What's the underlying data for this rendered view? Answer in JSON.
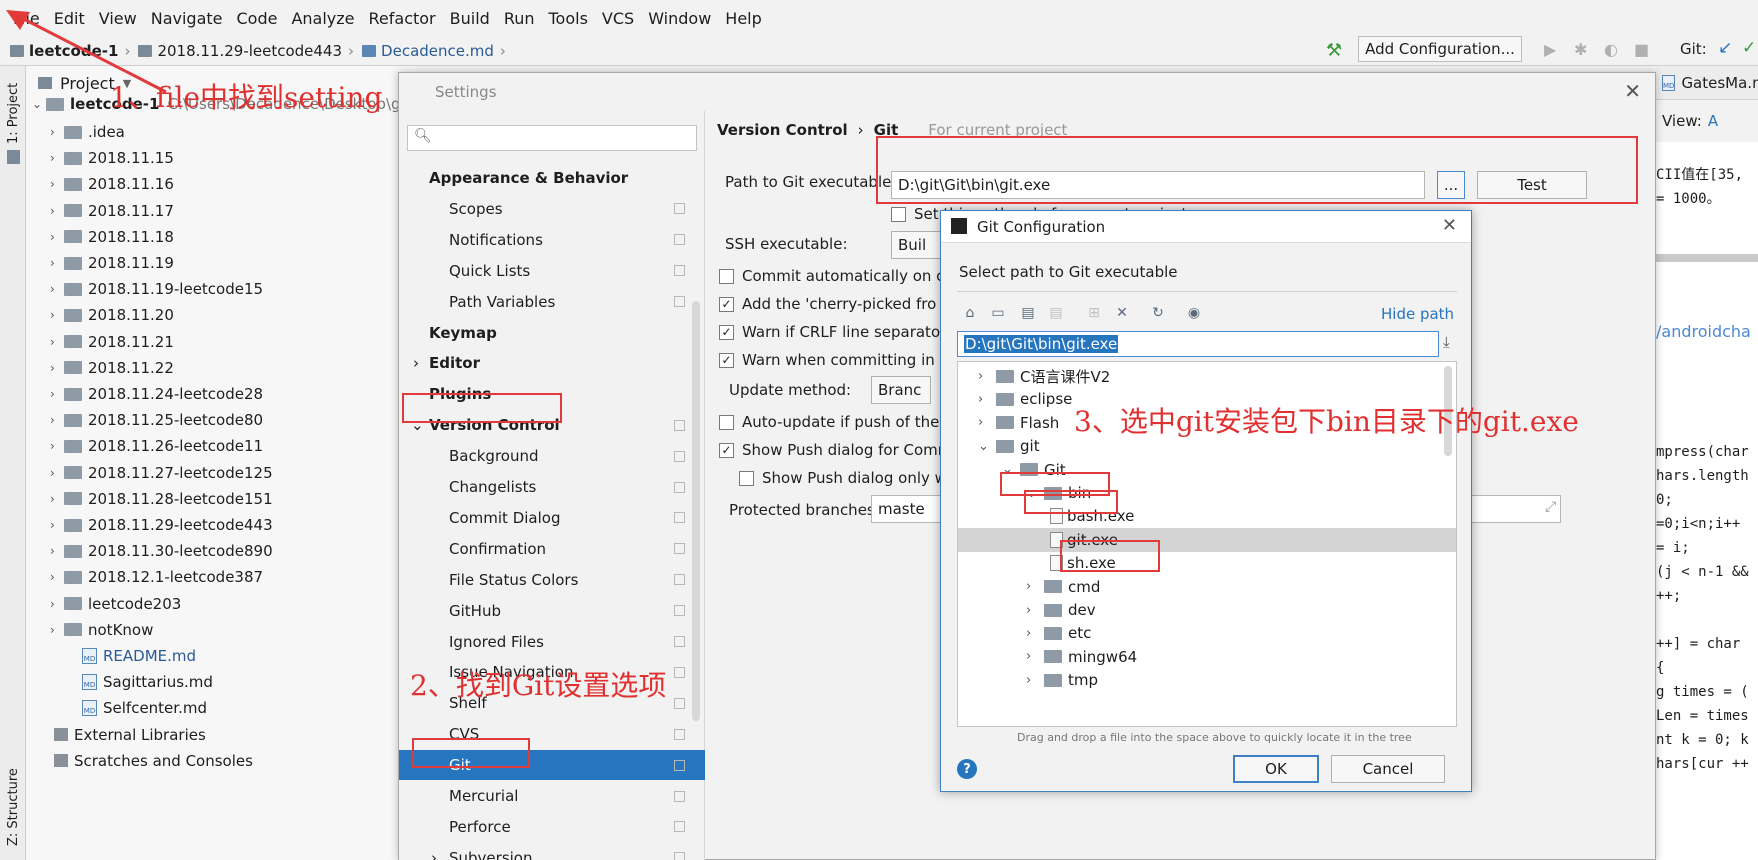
{
  "menubar": [
    "File",
    "Edit",
    "View",
    "Navigate",
    "Code",
    "Analyze",
    "Refactor",
    "Build",
    "Run",
    "Tools",
    "VCS",
    "Window",
    "Help"
  ],
  "navbar": {
    "crumbs": [
      "leetcode-1",
      "2018.11.29-leetcode443",
      "Decadence.md"
    ],
    "add_config": "Add Configuration...",
    "git_label": "Git:"
  },
  "sidetabs": {
    "project": "1: Project",
    "structure": "Z: Structure"
  },
  "project": {
    "header": "Project",
    "root": "leetcode-1",
    "root_path": "C:\\Users\\Decadence\\Desktop\\gi",
    "items": [
      ".idea",
      "2018.11.15",
      "2018.11.16",
      "2018.11.17",
      "2018.11.18",
      "2018.11.19",
      "2018.11.19-leetcode15",
      "2018.11.20",
      "2018.11.21",
      "2018.11.22",
      "2018.11.24-leetcode28",
      "2018.11.25-leetcode80",
      "2018.11.26-leetcode11",
      "2018.11.27-leetcode125",
      "2018.11.28-leetcode151",
      "2018.11.29-leetcode443",
      "2018.11.30-leetcode890",
      "2018.12.1-leetcode387",
      "leetcode203",
      "notKnow"
    ],
    "files": [
      "README.md",
      "Sagittarius.md",
      "Selfcenter.md"
    ],
    "external": "External Libraries",
    "scratches": "Scratches and Consoles"
  },
  "editor_tab": "GatesMa.md",
  "editor_view": "View:",
  "editor_lines": [
    "CII值在[35,",
    "= 1000。",
    "/androidcha",
    "mpress(char",
    "hars.length",
    "0;",
    "=0;i<n;i++",
    "= i;",
    "(j < n-1 &&",
    "++;",
    "++] = char",
    "{",
    "g times = (",
    "Len = times",
    "nt k = 0; k",
    "hars[cur ++"
  ],
  "settings": {
    "title": "Settings",
    "search_placeholder": "",
    "tree": [
      {
        "label": "Appearance & Behavior",
        "bold": true
      },
      {
        "label": "Scopes"
      },
      {
        "label": "Notifications"
      },
      {
        "label": "Quick Lists"
      },
      {
        "label": "Path Variables"
      },
      {
        "label": "Keymap",
        "bold": true
      },
      {
        "label": "Editor",
        "bold": true
      },
      {
        "label": "Plugins",
        "bold": true
      },
      {
        "label": "Version Control",
        "bold": true
      },
      {
        "label": "Background"
      },
      {
        "label": "Changelists"
      },
      {
        "label": "Commit Dialog"
      },
      {
        "label": "Confirmation"
      },
      {
        "label": "File Status Colors"
      },
      {
        "label": "GitHub"
      },
      {
        "label": "Ignored Files"
      },
      {
        "label": "Issue Navigation"
      },
      {
        "label": "Shelf"
      },
      {
        "label": "CVS"
      },
      {
        "label": "Git"
      },
      {
        "label": "Mercurial"
      },
      {
        "label": "Perforce"
      },
      {
        "label": "Subversion"
      }
    ],
    "breadcrumb": "Version Control",
    "breadcrumb_child": "Git",
    "for_project": "For current project",
    "path_label": "Path to Git executable:",
    "path_value": "D:\\git\\Git\\bin\\git.exe",
    "browse": "...",
    "test": "Test",
    "only_current": "Set this path only for current project",
    "ssh_label": "SSH executable:",
    "ssh_value": "Buil",
    "commit_auto": "Commit automatically on c",
    "cherry": "Add the 'cherry-picked fro",
    "crlf": "Warn if CRLF line separato",
    "warn_commit": "Warn when committing in c",
    "update_label": "Update method:",
    "update_value": "Branc",
    "auto_update": "Auto-update if push of the",
    "show_push": "Show Push dialog for Comr",
    "show_push_only": "Show Push dialog only w",
    "protected_label": "Protected branches:",
    "protected_value": "maste"
  },
  "git_dialog": {
    "title": "Git Configuration",
    "prompt": "Select path to Git executable",
    "hide_path": "Hide path",
    "path": "D:\\git\\Git\\bin\\git.exe",
    "tree": [
      {
        "label": "C语言课件V2",
        "indent": 1,
        "arrow": "›"
      },
      {
        "label": "eclipse",
        "indent": 1,
        "arrow": "›"
      },
      {
        "label": "Flash",
        "indent": 1,
        "arrow": "›"
      },
      {
        "label": "git",
        "indent": 1,
        "arrow": "⌄"
      },
      {
        "label": "Git",
        "indent": 2,
        "arrow": "⌄"
      },
      {
        "label": "bin",
        "indent": 3,
        "arrow": "⌄"
      },
      {
        "label": "bash.exe",
        "indent": 4,
        "file": true
      },
      {
        "label": "git.exe",
        "indent": 4,
        "file": true,
        "selected": true
      },
      {
        "label": "sh.exe",
        "indent": 4,
        "file": true
      },
      {
        "label": "cmd",
        "indent": 3,
        "arrow": "›"
      },
      {
        "label": "dev",
        "indent": 3,
        "arrow": "›"
      },
      {
        "label": "etc",
        "indent": 3,
        "arrow": "›"
      },
      {
        "label": "mingw64",
        "indent": 3,
        "arrow": "›"
      },
      {
        "label": "tmp",
        "indent": 3,
        "arrow": "›"
      }
    ],
    "hint": "Drag and drop a file into the space above to quickly locate it in the tree",
    "ok": "OK",
    "cancel": "Cancel"
  },
  "annotations": {
    "a1": "1、file中找到setting",
    "a2": "2、找到Git设置选项",
    "a3": "3、选中git安装包下bin目录下的git.exe"
  },
  "colors": {
    "accent": "#2675bf",
    "annotation": "#e23a3a"
  }
}
